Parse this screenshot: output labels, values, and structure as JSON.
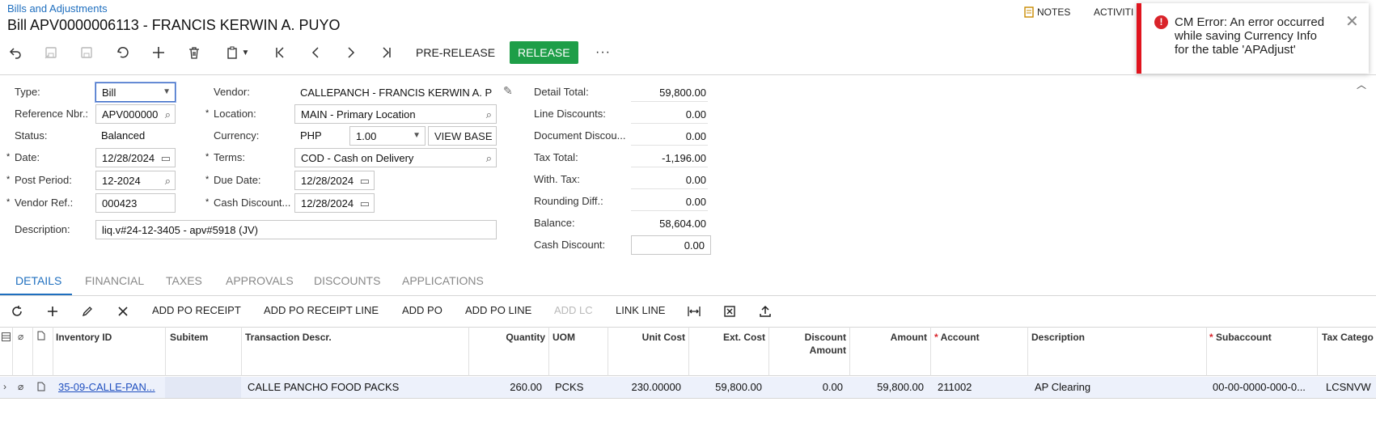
{
  "header": {
    "breadcrumb": "Bills and Adjustments",
    "title": "Bill APV0000006113 - FRANCIS KERWIN A. PUYO",
    "notes_label": "NOTES",
    "activities_label": "ACTIVITI"
  },
  "toolbar": {
    "pre_release_label": "PRE-RELEASE",
    "release_label": "RELEASE",
    "more_label": "···"
  },
  "toast": {
    "icon": "!",
    "message": "CM Error: An error occurred while saving Currency Info for the table 'APAdjust'",
    "close": "✕"
  },
  "form": {
    "type_label": "Type:",
    "type_value": "Bill",
    "ref_label": "Reference Nbr.:",
    "ref_value": "APV000000",
    "status_label": "Status:",
    "status_value": "Balanced",
    "date_label": "Date:",
    "date_value": "12/28/2024",
    "post_period_label": "Post Period:",
    "post_period_value": "12-2024",
    "vendor_ref_label": "Vendor Ref.:",
    "vendor_ref_value": "000423",
    "description_label": "Description:",
    "description_value": "liq.v#24-12-3405 - apv#5918 (JV)",
    "vendor_label": "Vendor:",
    "vendor_value": "CALLEPANCH - FRANCIS KERWIN A. P",
    "location_label": "Location:",
    "location_value": "MAIN - Primary Location",
    "currency_label": "Currency:",
    "currency_value": "PHP",
    "rate_value": "1.00",
    "view_base_label": "VIEW BASE",
    "terms_label": "Terms:",
    "terms_value": "COD - Cash on Delivery",
    "due_date_label": "Due Date:",
    "due_date_value": "12/28/2024",
    "cash_discount_date_label": "Cash Discount...",
    "cash_discount_date_value": "12/28/2024",
    "required_mark": "*"
  },
  "summary": {
    "detail_total_label": "Detail Total:",
    "detail_total": "59,800.00",
    "line_discounts_label": "Line Discounts:",
    "line_discounts": "0.00",
    "document_discount_label": "Document Discou...",
    "document_discount": "0.00",
    "tax_total_label": "Tax Total:",
    "tax_total": "-1,196.00",
    "with_tax_label": "With. Tax:",
    "with_tax": "0.00",
    "rounding_diff_label": "Rounding Diff.:",
    "rounding_diff": "0.00",
    "balance_label": "Balance:",
    "balance": "58,604.00",
    "cash_discount_label": "Cash Discount:",
    "cash_discount": "0.00"
  },
  "tabs": {
    "details": "DETAILS",
    "financial": "FINANCIAL",
    "taxes": "TAXES",
    "approvals": "APPROVALS",
    "discounts": "DISCOUNTS",
    "applications": "APPLICATIONS"
  },
  "grid_toolbar": {
    "add_po_receipt": "ADD PO RECEIPT",
    "add_po_receipt_line": "ADD PO RECEIPT LINE",
    "add_po": "ADD PO",
    "add_po_line": "ADD PO LINE",
    "add_lc": "ADD LC",
    "link_line": "LINK LINE"
  },
  "grid": {
    "columns": {
      "inventory_id": "Inventory ID",
      "subitem": "Subitem",
      "transaction_descr": "Transaction Descr.",
      "quantity": "Quantity",
      "uom": "UOM",
      "unit_cost": "Unit Cost",
      "ext_cost": "Ext. Cost",
      "discount_amount_1": "Discount",
      "discount_amount_2": "Amount",
      "amount": "Amount",
      "account": "Account",
      "description": "Description",
      "subaccount": "Subaccount",
      "tax_category": "Tax Catego"
    },
    "rows": [
      {
        "inventory_id": "35-09-CALLE-PAN...",
        "subitem": "",
        "transaction_descr": "CALLE PANCHO FOOD PACKS",
        "quantity": "260.00",
        "uom": "PCKS",
        "unit_cost": "230.00000",
        "ext_cost": "59,800.00",
        "discount_amount": "0.00",
        "amount": "59,800.00",
        "account": "211002",
        "description": "AP Clearing",
        "subaccount": "00-00-0000-000-0...",
        "tax_category": "LCSNVW"
      }
    ]
  }
}
